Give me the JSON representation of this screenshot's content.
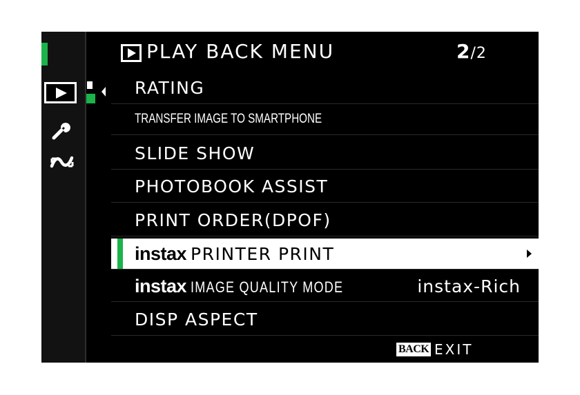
{
  "header": {
    "icon": "playback-icon",
    "title": "PLAY BACK MENU",
    "page_current": "2",
    "page_total": "/2"
  },
  "sidebar": {
    "tabs": [
      {
        "icon": "playback-tab-icon",
        "active": true
      },
      {
        "icon": "wrench-icon",
        "active": false
      },
      {
        "icon": "connection-icon",
        "active": false
      }
    ],
    "accent_color": "#1bb34a"
  },
  "menu": {
    "items": [
      {
        "label": "RATING"
      },
      {
        "label": "TRANSFER IMAGE TO SMARTPHONE"
      },
      {
        "label": "SLIDE SHOW"
      },
      {
        "label": "PHOTOBOOK ASSIST"
      },
      {
        "label": "PRINT ORDER(DPOF)"
      },
      {
        "brand": "instax",
        "label": "PRINTER PRINT",
        "selected": true
      },
      {
        "brand": "instax",
        "label": "IMAGE QUALITY MODE",
        "value": "instax-Rich"
      },
      {
        "label": "DISP ASPECT"
      }
    ]
  },
  "footer": {
    "back_badge": "BACK",
    "exit_label": "EXIT"
  }
}
